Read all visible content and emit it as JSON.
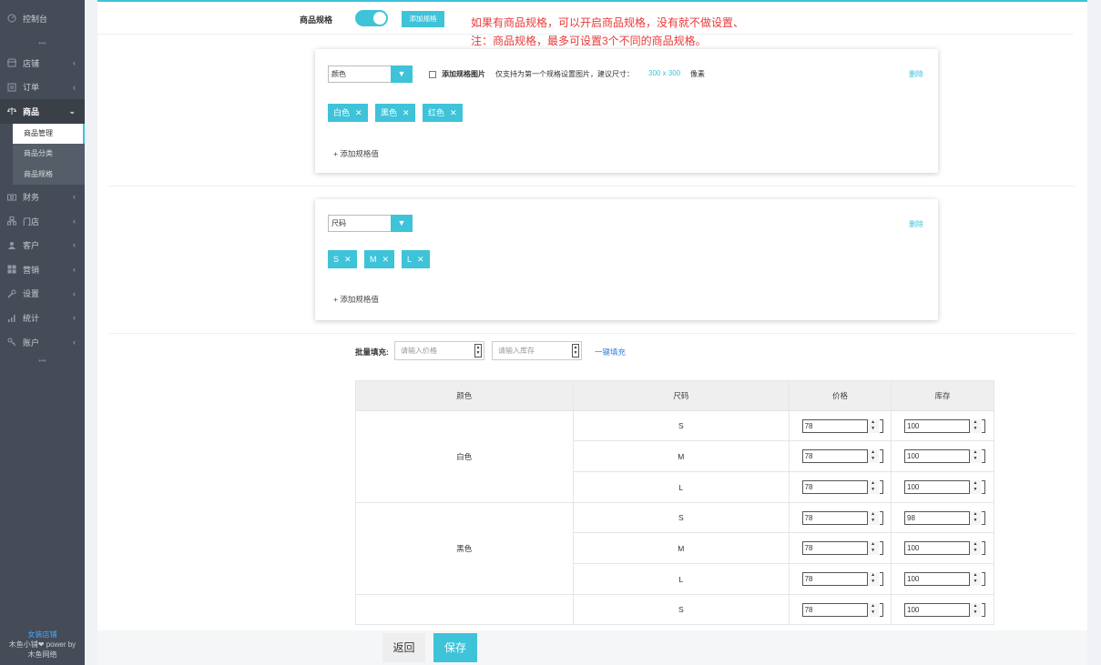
{
  "sidebar": {
    "items": [
      {
        "label": "控制台",
        "icon": "dashboard-icon"
      },
      {
        "label": "店铺",
        "icon": "store-icon"
      },
      {
        "label": "订单",
        "icon": "order-icon"
      },
      {
        "label": "商品",
        "icon": "goods-icon"
      },
      {
        "label": "财务",
        "icon": "finance-icon"
      },
      {
        "label": "门店",
        "icon": "branch-icon"
      },
      {
        "label": "客户",
        "icon": "customer-icon"
      },
      {
        "label": "营销",
        "icon": "marketing-icon"
      },
      {
        "label": "设置",
        "icon": "settings-icon"
      },
      {
        "label": "统计",
        "icon": "stats-icon"
      },
      {
        "label": "账户",
        "icon": "account-icon"
      }
    ],
    "subitems": [
      "商品管理",
      "商品分类",
      "商品规格"
    ],
    "dots": "•••",
    "footer": {
      "brand": "女装店铺",
      "line2": "木鱼小铺❤ power by",
      "line3": "木鱼网络"
    }
  },
  "spec": {
    "label": "商品规格",
    "add_button": "添加规格",
    "note_line1": "如果有商品规格，可以开启商品规格，没有就不做设置、",
    "note_line2": "注：商品规格，最多可设置3个不同的商品规格。"
  },
  "card1": {
    "select": "颜色",
    "img_checkbox_label": "添加规格图片",
    "img_hint": "仅支持为第一个规格设置图片，建议尺寸：",
    "img_size": "300 x 300",
    "img_unit": "像素",
    "delete": "删除",
    "tags": [
      "白色",
      "黑色",
      "红色"
    ],
    "add_value": "+ 添加规格值"
  },
  "card2": {
    "select": "尺码",
    "delete": "删除",
    "tags": [
      "S",
      "M",
      "L"
    ],
    "add_value": "+ 添加规格值"
  },
  "batch": {
    "label": "批量填充:",
    "price_placeholder": "请输入价格",
    "stock_placeholder": "请输入库存",
    "fill_link": "一键填充"
  },
  "table": {
    "headers": [
      "颜色",
      "尺码",
      "价格",
      "库存"
    ],
    "colors": [
      "白色",
      "黑色",
      ""
    ],
    "rows": [
      {
        "size": "S",
        "price": "78",
        "stock": "100"
      },
      {
        "size": "M",
        "price": "78",
        "stock": "100"
      },
      {
        "size": "L",
        "price": "78",
        "stock": "100"
      },
      {
        "size": "S",
        "price": "78",
        "stock": "98"
      },
      {
        "size": "M",
        "price": "78",
        "stock": "100"
      },
      {
        "size": "L",
        "price": "78",
        "stock": "100"
      },
      {
        "size": "S",
        "price": "78",
        "stock": "100"
      }
    ]
  },
  "footer": {
    "back": "返回",
    "save": "保存"
  },
  "colors": {
    "accent": "#3ec3d9",
    "note_red": "#e83a3a",
    "sidebar_bg": "#454c57"
  }
}
